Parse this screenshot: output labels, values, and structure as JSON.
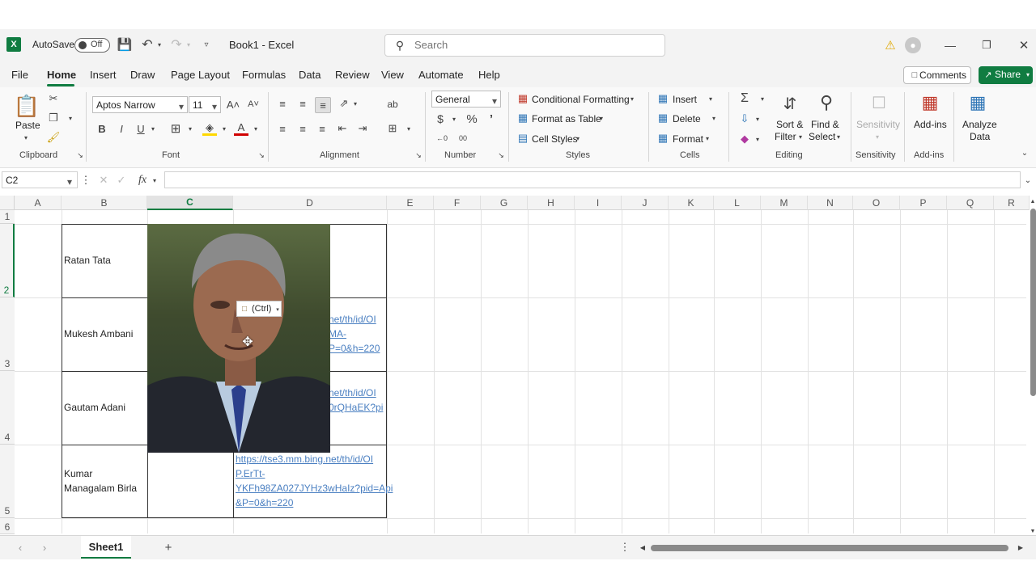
{
  "titlebar": {
    "autosave_label": "AutoSave",
    "autosave_state": "Off",
    "doc_title": "Book1 - Excel",
    "search_placeholder": "Search"
  },
  "menu": {
    "items": [
      "File",
      "Home",
      "Insert",
      "Draw",
      "Page Layout",
      "Formulas",
      "Data",
      "Review",
      "View",
      "Automate",
      "Help"
    ],
    "active": "Home",
    "comments_label": "Comments",
    "share_label": "Share"
  },
  "ribbon": {
    "clipboard": {
      "paste": "Paste",
      "group": "Clipboard"
    },
    "font": {
      "name": "Aptos Narrow",
      "size": "11",
      "group": "Font"
    },
    "alignment": {
      "group": "Alignment"
    },
    "number": {
      "format": "General",
      "group": "Number"
    },
    "styles": {
      "conditional": "Conditional Formatting",
      "table": "Format as Table",
      "cell": "Cell Styles",
      "group": "Styles"
    },
    "cells": {
      "insert": "Insert",
      "delete": "Delete",
      "format": "Format",
      "group": "Cells"
    },
    "editing": {
      "sort1": "Sort &",
      "sort2": "Filter",
      "find1": "Find &",
      "find2": "Select",
      "group": "Editing"
    },
    "sensitivity": {
      "label": "Sensitivity",
      "group": "Sensitivity"
    },
    "addins": {
      "label": "Add-ins",
      "group": "Add-ins"
    },
    "analyze": {
      "line1": "Analyze",
      "line2": "Data"
    }
  },
  "formula_bar": {
    "name_box": "C2",
    "fx": "fx",
    "value": ""
  },
  "columns": [
    "A",
    "B",
    "C",
    "D",
    "E",
    "F",
    "G",
    "H",
    "I",
    "J",
    "K",
    "L",
    "M",
    "N",
    "O",
    "P",
    "Q",
    "R"
  ],
  "rows": [
    "1",
    "2",
    "3",
    "4",
    "5",
    "6"
  ],
  "selected_cell": "C2",
  "table": {
    "names": [
      "Ratan Tata",
      "Mukesh Ambani",
      "Gautam Adani",
      "Kumar\nManagalam Birla"
    ],
    "row3_link": "net/th/id/OI\nMA-\nP=0&h=220",
    "row4_link": "net/th/id/OI\n0rQHaEK?pi",
    "row5_link": "https://tse3.mm.bing.net/th/id/OI\nP.ErTt-\nYKFh98ZA027JYHz3wHaIz?pid=Api\n&P=0&h=220"
  },
  "paste_options": "(Ctrl)",
  "sheets": [
    "Sheet1"
  ],
  "colors": {
    "accent": "#107c41",
    "link": "#4a7fc1",
    "warning": "#f2b600"
  }
}
